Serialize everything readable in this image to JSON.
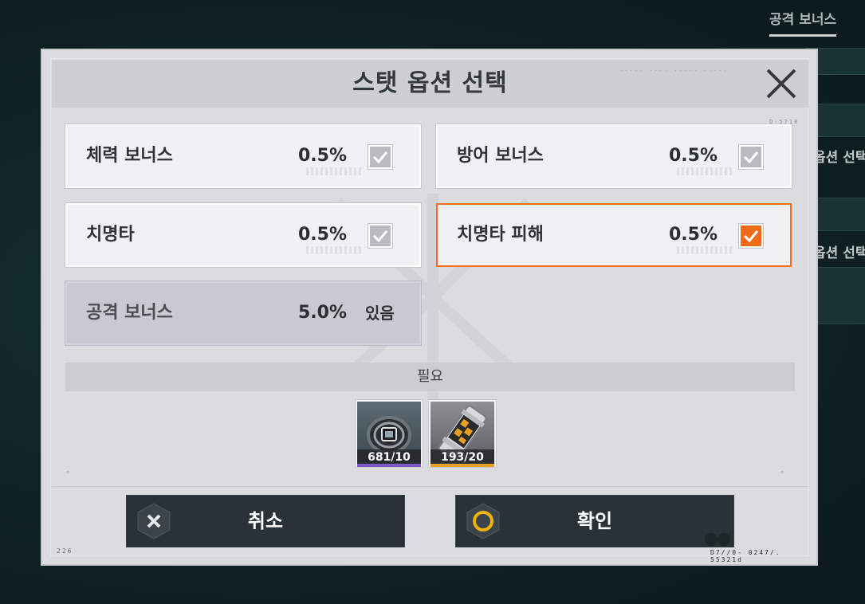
{
  "background": {
    "tab_label": "공격 보너스",
    "side_labels": [
      "옵션 선택",
      "옵션 선택"
    ]
  },
  "dialog": {
    "title": "스탯 옵션 선택",
    "close_icon": "close-icon"
  },
  "options": [
    {
      "label": "체력 보너스",
      "value": "0.5%",
      "checked": true,
      "selected": false
    },
    {
      "label": "방어 보너스",
      "value": "0.5%",
      "checked": true,
      "selected": false
    },
    {
      "label": "치명타",
      "value": "0.5%",
      "checked": true,
      "selected": false
    },
    {
      "label": "치명타 피해",
      "value": "0.5%",
      "checked": true,
      "selected": true
    },
    {
      "label": "공격 보너스",
      "value": "5.0%",
      "status": "있음",
      "disabled": true
    }
  ],
  "required": {
    "label": "필요",
    "items": [
      {
        "icon": "ring-module-icon",
        "count": "681/10",
        "rarity_color": "#7a5cc7"
      },
      {
        "icon": "canister-icon",
        "count": "193/20",
        "rarity_color": "#e6a21a"
      }
    ]
  },
  "buttons": {
    "cancel_label": "취소",
    "confirm_label": "확인"
  },
  "colors": {
    "accent": "#f07020",
    "button_bg": "#2a3237",
    "confirm_ring": "#f0b400"
  },
  "footer": {
    "left_code": "226",
    "right_code": "D7//0- 0247/. 55321d"
  }
}
